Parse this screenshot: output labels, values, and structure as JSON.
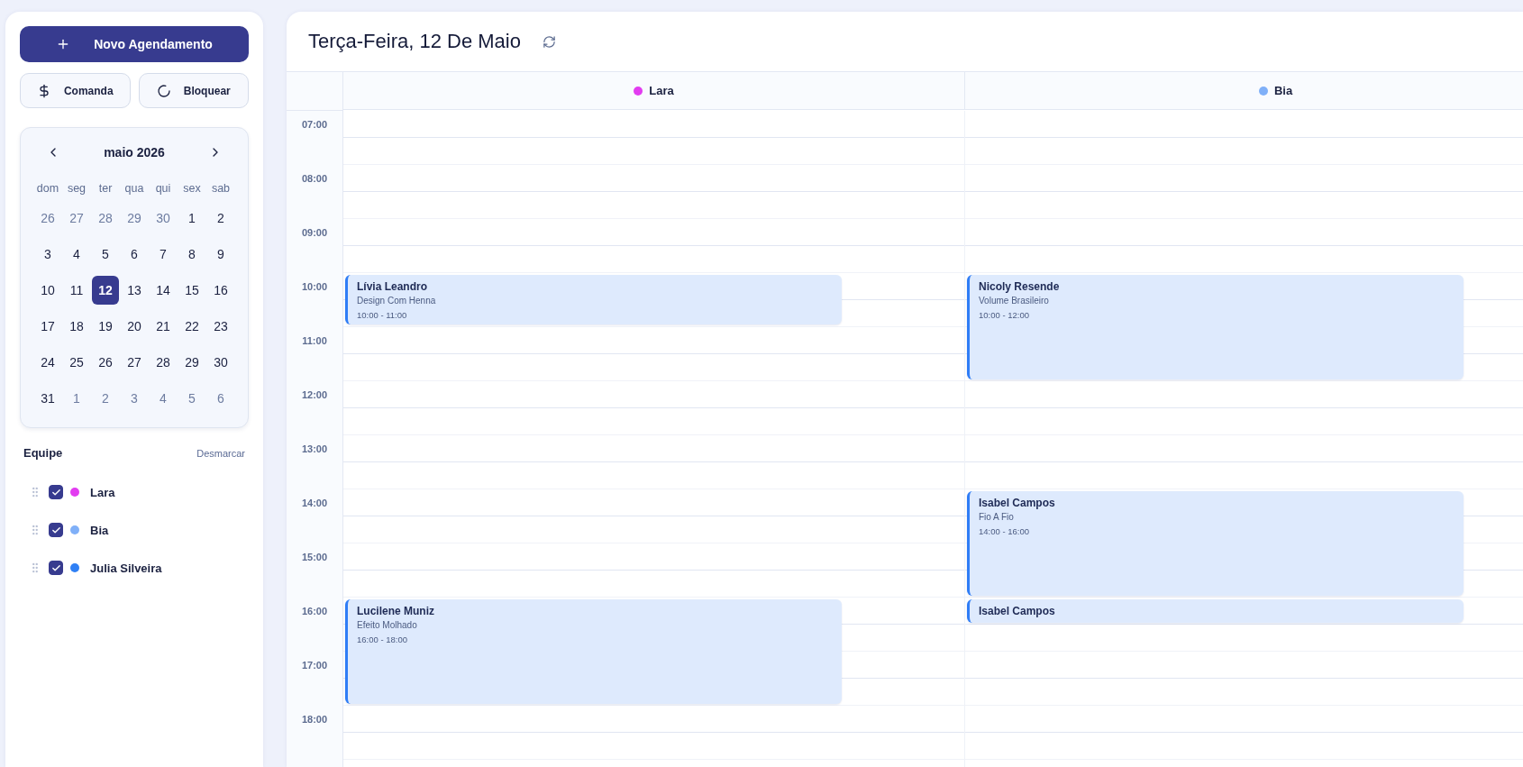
{
  "sidebar": {
    "new_button": "Novo Agendamento",
    "actions": [
      {
        "label": "Comanda",
        "kind": "money"
      },
      {
        "label": "Bloquear",
        "kind": "block"
      }
    ],
    "calendar": {
      "month": "maio 2026",
      "weekdays": [
        "dom",
        "seg",
        "ter",
        "qua",
        "qui",
        "sex",
        "sab"
      ],
      "days": [
        {
          "label": "26",
          "outside": true,
          "selected": false
        },
        {
          "label": "27",
          "outside": true,
          "selected": false
        },
        {
          "label": "28",
          "outside": true,
          "selected": false
        },
        {
          "label": "29",
          "outside": true,
          "selected": false
        },
        {
          "label": "30",
          "outside": true,
          "selected": false
        },
        {
          "label": "1",
          "outside": false,
          "selected": false
        },
        {
          "label": "2",
          "outside": false,
          "selected": false
        },
        {
          "label": "3",
          "outside": false,
          "selected": false
        },
        {
          "label": "4",
          "outside": false,
          "selected": false
        },
        {
          "label": "5",
          "outside": false,
          "selected": false
        },
        {
          "label": "6",
          "outside": false,
          "selected": false
        },
        {
          "label": "7",
          "outside": false,
          "selected": false
        },
        {
          "label": "8",
          "outside": false,
          "selected": false
        },
        {
          "label": "9",
          "outside": false,
          "selected": false
        },
        {
          "label": "10",
          "outside": false,
          "selected": false
        },
        {
          "label": "11",
          "outside": false,
          "selected": false
        },
        {
          "label": "12",
          "outside": false,
          "selected": true
        },
        {
          "label": "13",
          "outside": false,
          "selected": false
        },
        {
          "label": "14",
          "outside": false,
          "selected": false
        },
        {
          "label": "15",
          "outside": false,
          "selected": false
        },
        {
          "label": "16",
          "outside": false,
          "selected": false
        },
        {
          "label": "17",
          "outside": false,
          "selected": false
        },
        {
          "label": "18",
          "outside": false,
          "selected": false
        },
        {
          "label": "19",
          "outside": false,
          "selected": false
        },
        {
          "label": "20",
          "outside": false,
          "selected": false
        },
        {
          "label": "21",
          "outside": false,
          "selected": false
        },
        {
          "label": "22",
          "outside": false,
          "selected": false
        },
        {
          "label": "23",
          "outside": false,
          "selected": false
        },
        {
          "label": "24",
          "outside": false,
          "selected": false
        },
        {
          "label": "25",
          "outside": false,
          "selected": false
        },
        {
          "label": "26",
          "outside": false,
          "selected": false
        },
        {
          "label": "27",
          "outside": false,
          "selected": false
        },
        {
          "label": "28",
          "outside": false,
          "selected": false
        },
        {
          "label": "29",
          "outside": false,
          "selected": false
        },
        {
          "label": "30",
          "outside": false,
          "selected": false
        },
        {
          "label": "31",
          "outside": false,
          "selected": false
        },
        {
          "label": "1",
          "outside": true,
          "selected": false
        },
        {
          "label": "2",
          "outside": true,
          "selected": false
        },
        {
          "label": "3",
          "outside": true,
          "selected": false
        },
        {
          "label": "4",
          "outside": true,
          "selected": false
        },
        {
          "label": "5",
          "outside": true,
          "selected": false
        },
        {
          "label": "6",
          "outside": true,
          "selected": false
        }
      ]
    },
    "team": {
      "title": "Equipe",
      "clear_link": "Desmarcar",
      "members": [
        {
          "name": "Lara",
          "color": "#e23cf0",
          "checked": true
        },
        {
          "name": "Bia",
          "color": "#80b0f8",
          "checked": true
        },
        {
          "name": "Julia Silveira",
          "color": "#2f80f5",
          "checked": true
        }
      ]
    }
  },
  "main": {
    "title": "Terça-Feira, 12 De Maio",
    "columns": [
      {
        "name": "Lara",
        "color": "#e23cf0"
      },
      {
        "name": "Bia",
        "color": "#80b0f8"
      }
    ],
    "hours": [
      {
        "label": "07:00",
        "cells": [
          null,
          null
        ]
      },
      {
        "label": "08:00",
        "cells": [
          null,
          null
        ]
      },
      {
        "label": "09:00",
        "cells": [
          null,
          null
        ]
      },
      {
        "label": "10:00",
        "cells": [
          {
            "client": "Lívia Leandro",
            "service": "Design Com Henna",
            "time": "10:00 - 11:00",
            "kind": "short"
          },
          {
            "client": "Nicoly Resende",
            "service": "Volume Brasileiro",
            "time": "10:00 - 12:00",
            "kind": "tall"
          }
        ]
      },
      {
        "label": "11:00",
        "cells": [
          null,
          null
        ]
      },
      {
        "label": "12:00",
        "cells": [
          null,
          null
        ]
      },
      {
        "label": "13:00",
        "cells": [
          null,
          null
        ]
      },
      {
        "label": "14:00",
        "cells": [
          null,
          {
            "client": "Isabel Campos",
            "service": "Fio A Fio",
            "time": "14:00 - 16:00",
            "kind": "tall"
          }
        ]
      },
      {
        "label": "15:00",
        "cells": [
          null,
          null
        ]
      },
      {
        "label": "16:00",
        "cells": [
          {
            "client": "Lucilene Muniz",
            "service": "Efeito Molhado",
            "time": "16:00 - 18:00",
            "kind": "tall"
          },
          {
            "client": "Isabel Campos",
            "kind": "compact"
          }
        ]
      },
      {
        "label": "17:00",
        "cells": [
          null,
          null
        ]
      },
      {
        "label": "18:00",
        "cells": [
          null,
          null
        ]
      }
    ]
  }
}
